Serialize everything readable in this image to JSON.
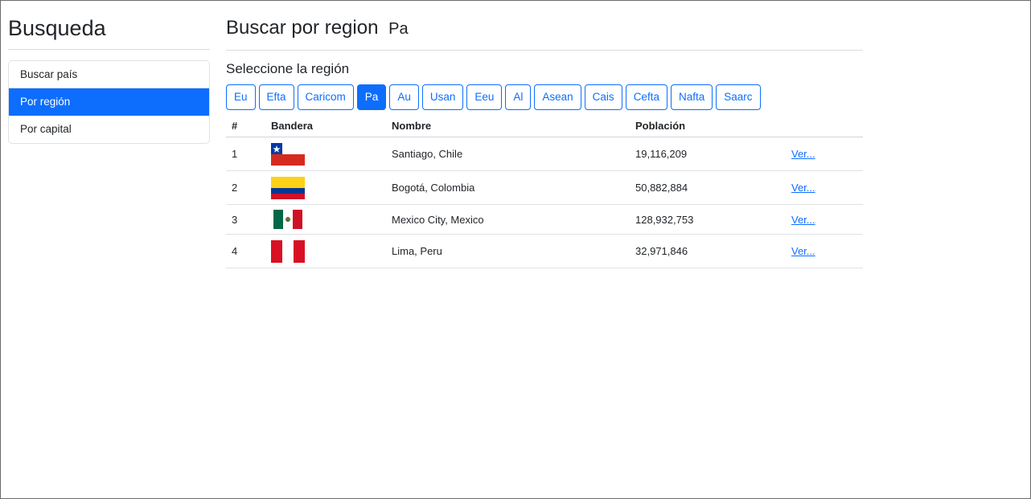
{
  "sidebar": {
    "title": "Busqueda",
    "items": [
      {
        "label": "Buscar país",
        "active": false
      },
      {
        "label": "Por región",
        "active": true
      },
      {
        "label": "Por capital",
        "active": false
      }
    ]
  },
  "main": {
    "title": "Buscar por region",
    "region_active": "Pa",
    "subtitle": "Seleccione la región",
    "regions": [
      "Eu",
      "Efta",
      "Caricom",
      "Pa",
      "Au",
      "Usan",
      "Eeu",
      "Al",
      "Asean",
      "Cais",
      "Cefta",
      "Nafta",
      "Saarc"
    ]
  },
  "table": {
    "headers": [
      "#",
      "Bandera",
      "Nombre",
      "Población",
      ""
    ],
    "rows": [
      {
        "num": "1",
        "flag": "chile-flag",
        "name": "Santiago, Chile",
        "population": "19,116,209",
        "link": "Ver..."
      },
      {
        "num": "2",
        "flag": "colombia-flag",
        "name": "Bogotá, Colombia",
        "population": "50,882,884",
        "link": "Ver..."
      },
      {
        "num": "3",
        "flag": "mexico-flag",
        "name": "Mexico City, Mexico",
        "population": "128,932,753",
        "link": "Ver..."
      },
      {
        "num": "4",
        "flag": "peru-flag",
        "name": "Lima, Peru",
        "population": "32,971,846",
        "link": "Ver..."
      }
    ]
  },
  "colors": {
    "accent": "#0d6efd",
    "text": "#212529"
  }
}
